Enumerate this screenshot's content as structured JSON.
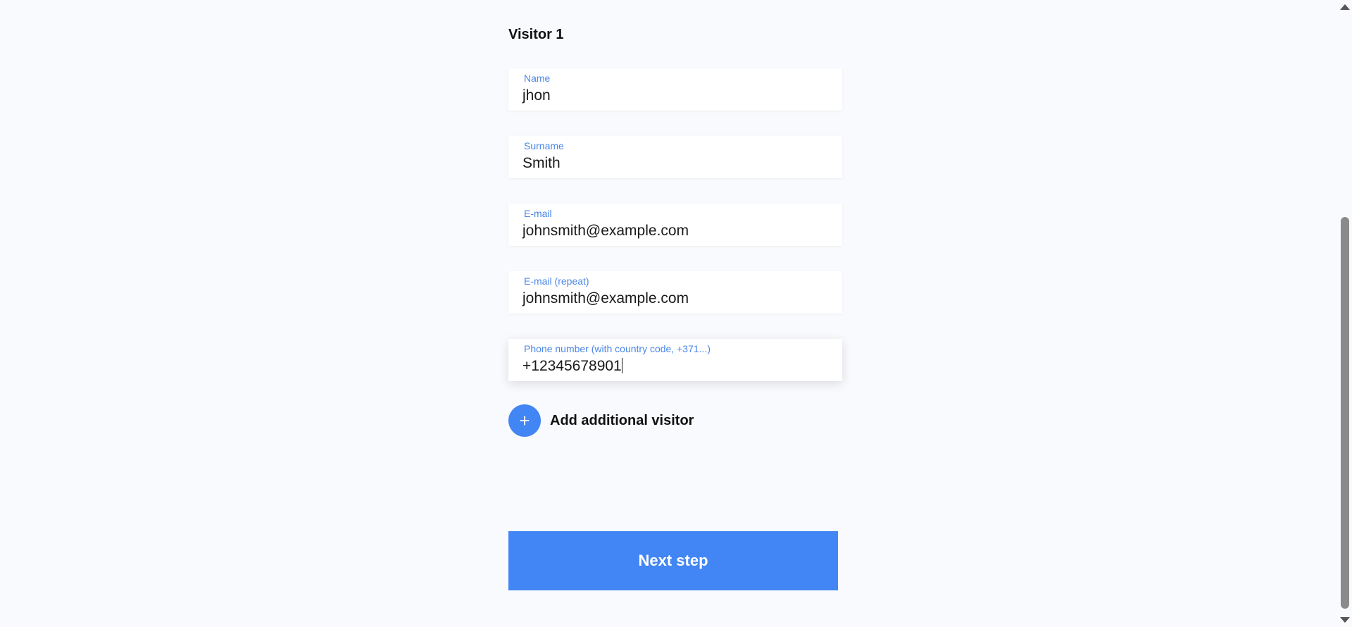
{
  "visitor": {
    "title": "Visitor 1"
  },
  "fields": {
    "name": {
      "label": "Name",
      "value": "jhon"
    },
    "surname": {
      "label": "Surname",
      "value": "Smith"
    },
    "email": {
      "label": "E-mail",
      "value": "johnsmith@example.com"
    },
    "email_repeat": {
      "label": "E-mail (repeat)",
      "value": "johnsmith@example.com"
    },
    "phone": {
      "label": "Phone number (with country code, +371...)",
      "value": "+12345678901"
    }
  },
  "add_visitor": {
    "icon": "plus-icon",
    "symbol": "+",
    "label": "Add additional visitor"
  },
  "next": {
    "label": "Next step"
  },
  "colors": {
    "accent": "#4285f4",
    "label": "#4a86e8",
    "background": "#f8fafd"
  }
}
